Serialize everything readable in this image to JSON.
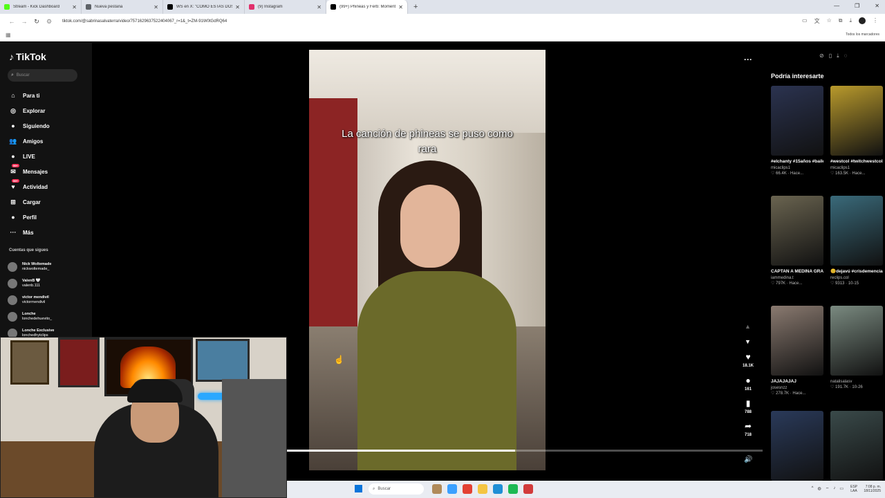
{
  "browser": {
    "tabs": [
      {
        "label": "Stream - Kick Dashboard",
        "color": "#53fc18",
        "active": false
      },
      {
        "label": "Nueva pestaña",
        "color": "#5f6368",
        "active": false
      },
      {
        "label": "WS en X: \"COMO ESTAS DOS F",
        "color": "#000000",
        "active": false
      },
      {
        "label": "(9) Instagram",
        "color": "#e1306c",
        "active": false
      },
      {
        "label": "(99+) Phineas y Ferb: Momento",
        "color": "#000000",
        "active": true
      }
    ],
    "url": "tiktok.com/@sabrinasalvaterra/video/7571629637522404067_r=1&_t=ZM-91W0tGdRQ64",
    "bookmarks_label": "Todos los marcadores"
  },
  "sidebar": {
    "logo": "TikTok",
    "search_placeholder": "Buscar",
    "nav": [
      {
        "icon": "home-icon",
        "glyph": "⌂",
        "label": "Para ti"
      },
      {
        "icon": "compass-icon",
        "glyph": "◎",
        "label": "Explorar"
      },
      {
        "icon": "following-icon",
        "glyph": "●",
        "label": "Siguiendo"
      },
      {
        "icon": "friends-icon",
        "glyph": "👥",
        "label": "Amigos"
      },
      {
        "icon": "live-icon",
        "glyph": "●",
        "label": "LIVE"
      },
      {
        "icon": "messages-icon",
        "glyph": "✉",
        "label": "Mensajes",
        "badge": "99+"
      },
      {
        "icon": "activity-icon",
        "glyph": "♥",
        "label": "Actividad",
        "badge": "99+"
      },
      {
        "icon": "upload-icon",
        "glyph": "⊞",
        "label": "Cargar"
      },
      {
        "icon": "profile-icon",
        "glyph": "●",
        "label": "Perfil"
      },
      {
        "icon": "more-icon",
        "glyph": "···",
        "label": "Más"
      }
    ],
    "following_title": "Cuentas que sigues",
    "following": [
      {
        "name": "Nick Woltemade",
        "handle": "nickwoltemade_"
      },
      {
        "name": "ValenB 🤍",
        "handle": "valenb.111"
      },
      {
        "name": "victor mendivil",
        "handle": "victormendivil"
      },
      {
        "name": "Lonche",
        "handle": "lonchedehuevito_"
      },
      {
        "name": "Lonche Exclusive",
        "handle": "lonchedhytclips"
      }
    ]
  },
  "video": {
    "caption": "La canción de phineas se puso como rara",
    "progress": 0.48,
    "likes": "18.1K",
    "comments": "161",
    "saves": "788",
    "shares": "718"
  },
  "suggestions": {
    "title": "Podría interesarte",
    "items": [
      {
        "title": "#elchanty #15años #baile #cancion",
        "user": "micaclips1",
        "meta": "♡ 66.4K · Hace...",
        "color": "#2b3350"
      },
      {
        "title": "#westcol #twitchwestcol...",
        "user": "micaclips1",
        "meta": "♡ 163.5K · Hace...",
        "color": "#b99a2c"
      },
      {
        "title": "CAPTAN A MEDINA GRABANDO...",
        "user": "iammedina.t",
        "meta": "♡ 797K · Hace...",
        "color": "#6a6450"
      },
      {
        "title": "😊dejavú #crisdemencia...",
        "user": "reclips.col",
        "meta": "♡ 9313 · 10-15",
        "color": "#3a6a7a"
      },
      {
        "title": "JAJAJAJAJ",
        "user": "josesnzz",
        "meta": "♡ 278.7K · Hace...",
        "color": "#8a7a70"
      },
      {
        "title": "",
        "user": "natalisalasv",
        "meta": "♡ 191.7K · 10-26",
        "color": "#7a8a80"
      },
      {
        "title": "",
        "user": "",
        "meta": "",
        "color": "#2a3a5a"
      },
      {
        "title": "",
        "user": "",
        "meta": "",
        "color": "#3a4a4a"
      }
    ]
  },
  "taskbar": {
    "search_placeholder": "Buscar",
    "lang": "ESP\nLAA",
    "time": "7:08 p. m.",
    "date": "18/11/2025"
  }
}
